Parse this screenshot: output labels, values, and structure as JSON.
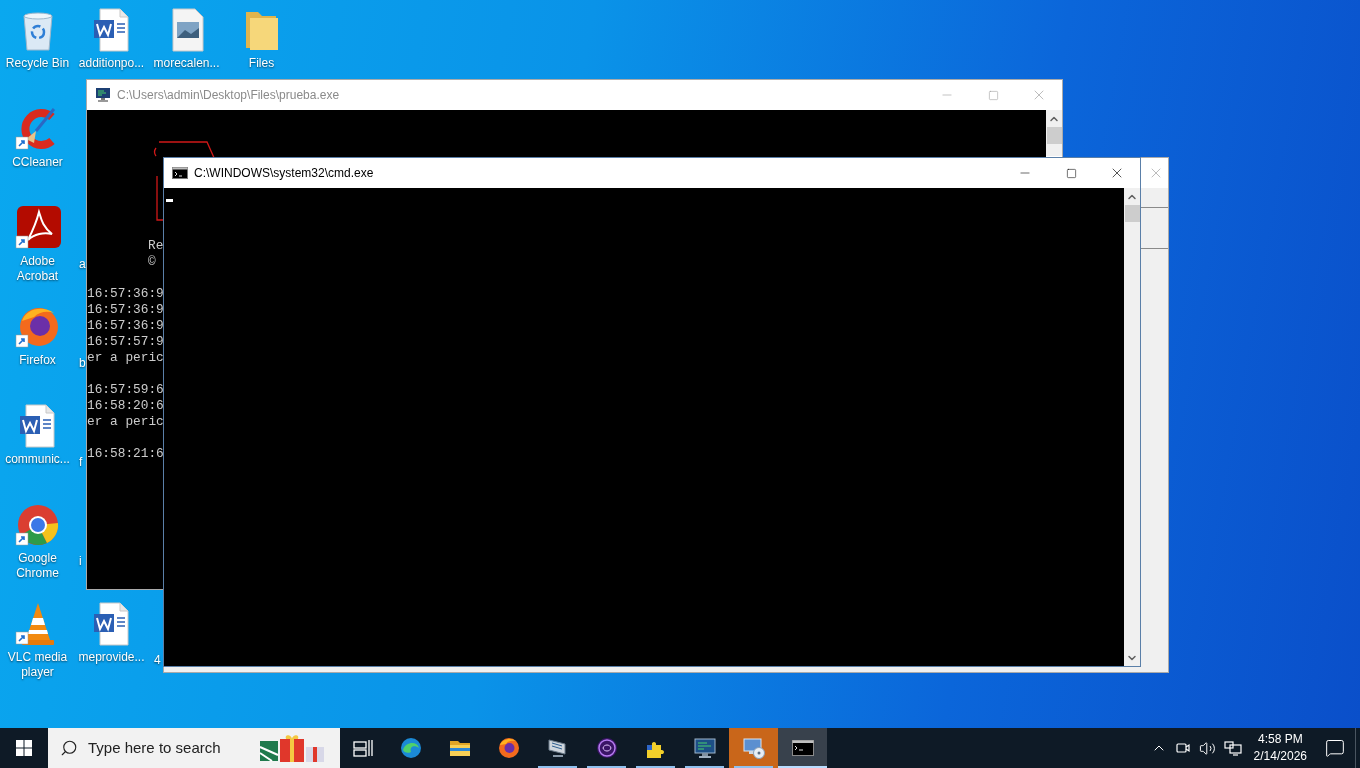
{
  "desktop_icons": [
    {
      "label": "Recycle Bin",
      "kind": "recycle-bin",
      "shortcut": false
    },
    {
      "label": "additionpo...",
      "kind": "word-document",
      "shortcut": false
    },
    {
      "label": "morecalen...",
      "kind": "image-file",
      "shortcut": false
    },
    {
      "label": "Files",
      "kind": "folder",
      "shortcut": false
    },
    {
      "label": "CCleaner",
      "kind": "ccleaner",
      "shortcut": true
    },
    {
      "label": "Adobe Acrobat",
      "kind": "acrobat",
      "shortcut": true
    },
    {
      "label": "Firefox",
      "kind": "firefox",
      "shortcut": true
    },
    {
      "label": "communic...",
      "kind": "word-document",
      "shortcut": false
    },
    {
      "label": "Google Chrome",
      "kind": "chrome",
      "shortcut": true
    },
    {
      "label": "VLC media player",
      "kind": "vlc",
      "shortcut": true
    },
    {
      "label": "meprovide...",
      "kind": "word-document",
      "shortcut": false
    }
  ],
  "covered_icon_labels": [
    "a",
    "b",
    "f",
    "i",
    "4"
  ],
  "windows": [
    {
      "kind": "program",
      "title": "C:\\Users\\admin\\Desktop\\Files\\prueba.exe",
      "active": false,
      "cursor": false,
      "banner": [
        "Re",
        "©"
      ],
      "log_blocks": [
        [
          "16:57:36:9",
          "16:57:36:9",
          "16:57:36:9",
          "16:57:57:9",
          "er a peric"
        ],
        [
          "16:57:59:6",
          "16:58:20:6",
          "er a peric"
        ],
        [
          "16:58:21:6"
        ]
      ]
    },
    {
      "kind": "backdrop",
      "active": false
    },
    {
      "kind": "terminal",
      "title": "C:\\WINDOWS\\system32\\cmd.exe",
      "active": true,
      "cursor": true
    }
  ],
  "taskbar": {
    "search_placeholder": "Type here to search",
    "apps": [
      {
        "kind": "edge",
        "running": false,
        "flashing": false,
        "selected": false
      },
      {
        "kind": "explorer",
        "running": false,
        "flashing": false,
        "selected": false
      },
      {
        "kind": "firefox",
        "running": false,
        "flashing": false,
        "selected": false
      },
      {
        "kind": "screens",
        "running": true,
        "flashing": false,
        "selected": false
      },
      {
        "kind": "orb",
        "running": true,
        "flashing": false,
        "selected": false
      },
      {
        "kind": "puzzle",
        "running": true,
        "flashing": false,
        "selected": false
      },
      {
        "kind": "monitor",
        "running": true,
        "flashing": false,
        "selected": false
      },
      {
        "kind": "disc-monitor",
        "running": true,
        "flashing": true,
        "selected": false
      },
      {
        "kind": "terminal",
        "running": true,
        "flashing": false,
        "selected": true
      }
    ],
    "time": "4:58 PM",
    "date": "2/14/2026"
  }
}
